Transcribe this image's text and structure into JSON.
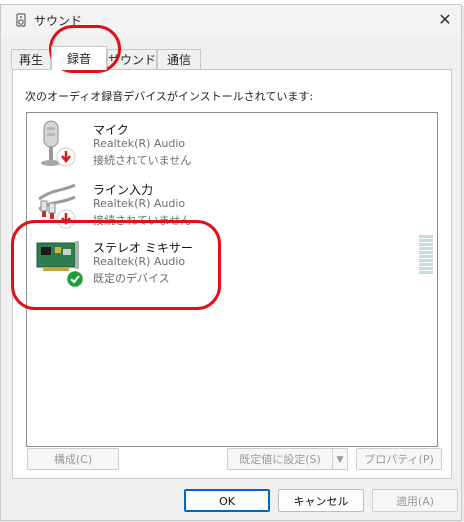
{
  "window": {
    "title": "サウンド",
    "close_symbol": "✕"
  },
  "tabs": [
    {
      "label": "再生"
    },
    {
      "label": "録音"
    },
    {
      "label": "サウンド"
    },
    {
      "label": "通信"
    }
  ],
  "active_tab": "録音",
  "instructions": "次のオーディオ録音デバイスがインストールされています:",
  "devices": [
    {
      "name": "マイク",
      "driver": "Realtek(R) Audio",
      "status": "接続されていません",
      "icon": "microphone-icon",
      "badge": "disconnected-badge"
    },
    {
      "name": "ライン入力",
      "driver": "Realtek(R) Audio",
      "status": "接続されていません",
      "icon": "line-in-cable-icon",
      "badge": "disconnected-badge"
    },
    {
      "name": "ステレオ ミキサー",
      "driver": "Realtek(R) Audio",
      "status": "既定のデバイス",
      "icon": "sound-card-icon",
      "badge": "default-check-badge"
    }
  ],
  "buttons": {
    "configure": "構成(C)",
    "set_default": "既定値に設定(S)",
    "properties": "プロパティ(P)",
    "ok": "OK",
    "cancel": "キャンセル",
    "apply": "適用(A)"
  },
  "colors": {
    "annotation": "#e0101a",
    "accent": "#0067c0",
    "default_check": "#1f9d3a",
    "disconnected_arrow": "#d01c1c"
  }
}
